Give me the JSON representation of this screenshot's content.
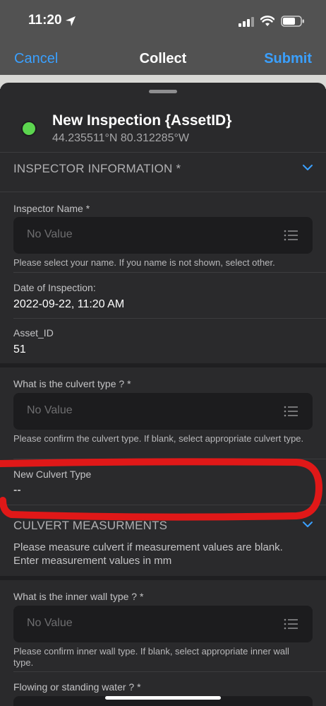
{
  "status": {
    "time": "11:20"
  },
  "nav": {
    "cancel": "Cancel",
    "title": "Collect",
    "submit": "Submit"
  },
  "record": {
    "title": "New Inspection {AssetID}",
    "coords": "44.235511°N  80.312285°W"
  },
  "section1": {
    "title": "INSPECTOR INFORMATION *",
    "inspector_name": {
      "label": "Inspector Name *",
      "placeholder": "No Value",
      "hint": "Please select your name. If you name is not shown, select other."
    },
    "date": {
      "label": "Date of Inspection:",
      "value": "2022-09-22, 11:20 AM"
    },
    "asset": {
      "label": "Asset_ID",
      "value": "51"
    }
  },
  "culvert_type": {
    "label": "What is the culvert type ? *",
    "placeholder": "No Value",
    "hint": "Please confirm the culvert type. If blank, select appropriate culvert type."
  },
  "new_culvert_type": {
    "label": "New Culvert Type",
    "value": "--"
  },
  "section2": {
    "title": "CULVERT MEASURMENTS",
    "description": "Please measure culvert if measurement values are blank. Enter measurement values in mm"
  },
  "inner_wall": {
    "label": "What is the inner wall type ? *",
    "placeholder": "No Value",
    "hint": "Please confirm inner wall type. If blank, select appropriate inner wall type."
  },
  "water": {
    "label": "Flowing or standing water ? *"
  },
  "colors": {
    "accent": "#3aa0ff",
    "status_green": "#5cd54f",
    "annotation_red": "#e01818"
  }
}
